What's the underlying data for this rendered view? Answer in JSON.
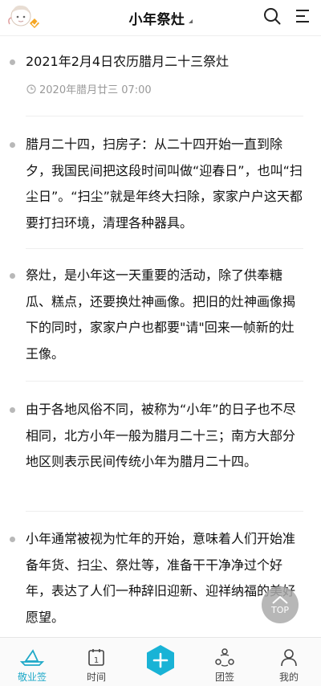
{
  "header": {
    "title": "小年祭灶"
  },
  "entries": [
    {
      "text": "2021年2月4日农历腊月二十三祭灶",
      "date": "2020年腊月廿三 07:00"
    },
    {
      "text": "腊月二十四，扫房子：从二十四开始一直到除夕，我国民间把这段时间叫做“迎春日”，也叫“扫尘日”。“扫尘”就是年终大扫除，家家户户这天都要打扫环境，清理各种器具。"
    },
    {
      "text": "祭灶，是小年这一天重要的活动，除了供奉糖瓜、糕点，还要换灶神画像。把旧的灶神画像揭下的同时，家家户户也都要\"请\"回来一帧新的灶王像。"
    },
    {
      "text": "由于各地风俗不同，被称为“小年”的日子也不尽相同，北方小年一般为腊月二十三；南方大部分地区则表示民间传统小年为腊月二十四。"
    },
    {
      "text": "小年通常被视为忙年的开始，意味着人们开始准备年货、扫尘、祭灶等，准备干干净净过个好年，表达了人们一种辞旧迎新、迎祥纳福的美好愿望。"
    }
  ],
  "top_button": {
    "label": "TOP"
  },
  "tabs": [
    {
      "label": "敬业签",
      "icon": "boat-icon",
      "active": true
    },
    {
      "label": "时间",
      "icon": "calendar-icon",
      "calendar_day": "1"
    },
    {
      "label": "",
      "icon": "add-icon"
    },
    {
      "label": "团签",
      "icon": "team-icon"
    },
    {
      "label": "我的",
      "icon": "user-icon"
    }
  ],
  "colors": {
    "accent": "#1fa9c8",
    "add_button": "#19b3d6",
    "bullet": "#b8b8b8",
    "avatar_badge": "#f5a623"
  }
}
